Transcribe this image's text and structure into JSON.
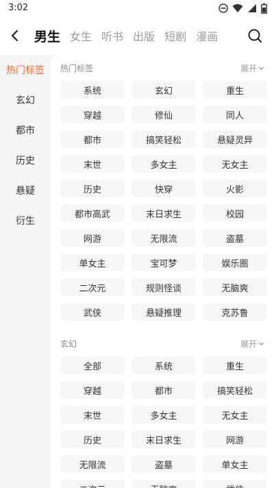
{
  "status": {
    "time": "3:02"
  },
  "nav": {
    "tabs": [
      {
        "label": "男生",
        "active": true
      },
      {
        "label": "女生",
        "active": false
      },
      {
        "label": "听书",
        "active": false
      },
      {
        "label": "出版",
        "active": false
      },
      {
        "label": "短剧",
        "active": false
      },
      {
        "label": "漫画",
        "active": false
      }
    ]
  },
  "sidebar": {
    "items": [
      {
        "label": "热门标签",
        "active": true
      },
      {
        "label": "玄幻",
        "active": false
      },
      {
        "label": "都市",
        "active": false
      },
      {
        "label": "历史",
        "active": false
      },
      {
        "label": "悬疑",
        "active": false
      },
      {
        "label": "衍生",
        "active": false
      }
    ]
  },
  "sections": [
    {
      "title": "热门标签",
      "expand_label": "展开",
      "tags": [
        "系统",
        "玄幻",
        "重生",
        "穿越",
        "修仙",
        "同人",
        "都市",
        "搞笑轻松",
        "悬疑灵异",
        "末世",
        "多女主",
        "无女主",
        "历史",
        "快穿",
        "火影",
        "都市高武",
        "末日求生",
        "校园",
        "网游",
        "无限流",
        "盗墓",
        "单女主",
        "宝可梦",
        "娱乐圈",
        "二次元",
        "规则怪谈",
        "无脑爽",
        "武侠",
        "悬疑推理",
        "克苏鲁"
      ]
    },
    {
      "title": "玄幻",
      "expand_label": "展开",
      "tags": [
        "全部",
        "系统",
        "重生",
        "穿越",
        "都市",
        "搞笑轻松",
        "末世",
        "多女主",
        "无女主",
        "历史",
        "末日求生",
        "网游",
        "无限流",
        "盗墓",
        "单女主",
        "二次元",
        "无脑爽",
        "武侠"
      ]
    }
  ],
  "colors": {
    "accent": "#f06a2a",
    "tag_bg": "#f6f6f6",
    "page_bg": "#f5f5f5"
  }
}
